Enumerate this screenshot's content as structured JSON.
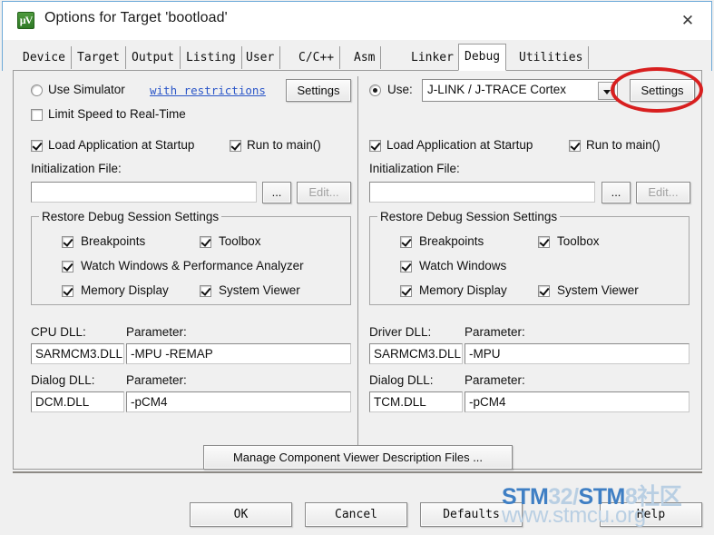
{
  "window": {
    "title": "Options for Target 'bootload'",
    "icon": "uvision-logo-icon",
    "close_label": "✕"
  },
  "tabs": [
    {
      "label": "Device",
      "selected": false
    },
    {
      "label": "Target",
      "selected": false
    },
    {
      "label": "Output",
      "selected": false
    },
    {
      "label": "Listing",
      "selected": false
    },
    {
      "label": "User",
      "selected": false
    },
    {
      "label": "C/C++",
      "selected": false
    },
    {
      "label": "Asm",
      "selected": false
    },
    {
      "label": "Linker",
      "selected": false
    },
    {
      "label": "Debug",
      "selected": true
    },
    {
      "label": "Utilities",
      "selected": false
    }
  ],
  "simulator": {
    "radio_label": "Use Simulator",
    "radio_checked": false,
    "restrictions_link": "with restrictions",
    "settings_button": "Settings",
    "limit_speed_label": "Limit Speed to Real-Time",
    "limit_speed_checked": false,
    "load_app_label": "Load Application at Startup",
    "load_app_checked": true,
    "run_to_main_label": "Run to main()",
    "run_to_main_checked": true,
    "init_file_label": "Initialization File:",
    "init_file_value": "",
    "browse_button": "...",
    "edit_button": "Edit...",
    "restore_group_title": "Restore Debug Session Settings",
    "restore_items": [
      {
        "label": "Breakpoints",
        "checked": true
      },
      {
        "label": "Toolbox",
        "checked": true
      },
      {
        "label": "Watch Windows & Performance Analyzer",
        "checked": true
      },
      {
        "label": "Memory Display",
        "checked": true
      },
      {
        "label": "System Viewer",
        "checked": true
      }
    ],
    "cpu_dll_label": "CPU DLL:",
    "cpu_dll_value": "SARMCM3.DLL",
    "cpu_param_label": "Parameter:",
    "cpu_param_value": "-MPU -REMAP",
    "dialog_dll_label": "Dialog DLL:",
    "dialog_dll_value": "DCM.DLL",
    "dialog_param_label": "Parameter:",
    "dialog_param_value": "-pCM4"
  },
  "target": {
    "radio_label": "Use:",
    "radio_checked": true,
    "driver_selected": "J-LINK / J-TRACE Cortex",
    "settings_button": "Settings",
    "load_app_label": "Load Application at Startup",
    "load_app_checked": true,
    "run_to_main_label": "Run to main()",
    "run_to_main_checked": true,
    "init_file_label": "Initialization File:",
    "init_file_value": "",
    "browse_button": "...",
    "edit_button": "Edit...",
    "restore_group_title": "Restore Debug Session Settings",
    "restore_items": [
      {
        "label": "Breakpoints",
        "checked": true
      },
      {
        "label": "Toolbox",
        "checked": true
      },
      {
        "label": "Watch Windows",
        "checked": true
      },
      {
        "label": "Memory Display",
        "checked": true
      },
      {
        "label": "System Viewer",
        "checked": true
      }
    ],
    "driver_dll_label": "Driver DLL:",
    "driver_dll_value": "SARMCM3.DLL",
    "driver_param_label": "Parameter:",
    "driver_param_value": "-MPU",
    "dialog_dll_label": "Dialog DLL:",
    "dialog_dll_value": "TCM.DLL",
    "dialog_param_label": "Parameter:",
    "dialog_param_value": "-pCM4"
  },
  "footer": {
    "manage_button": "Manage Component Viewer Description Files ...",
    "ok_button": "OK",
    "cancel_button": "Cancel",
    "defaults_button": "Defaults",
    "help_button": "Help"
  },
  "watermark": {
    "line1_a": "STM",
    "line1_b": "32/",
    "line1_c": "STM",
    "line1_d": "8社区",
    "line2": "www.stmcu.org"
  },
  "annotation": {
    "shape": "red-ellipse",
    "color": "#d81f1f",
    "targets": "target-settings-button"
  }
}
